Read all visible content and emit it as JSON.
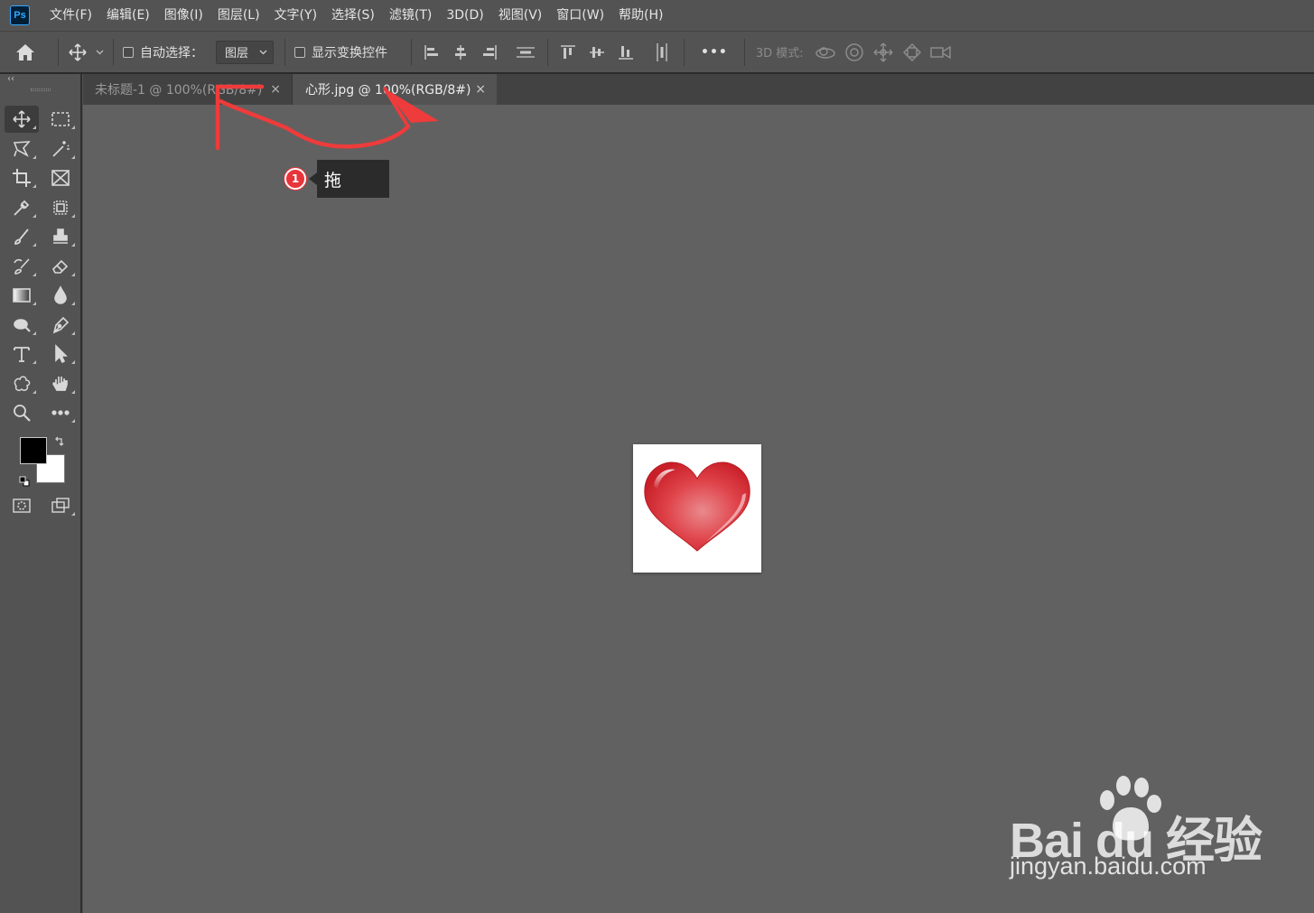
{
  "app": {
    "logo_text": "Ps"
  },
  "menu": [
    "文件(F)",
    "编辑(E)",
    "图像(I)",
    "图层(L)",
    "文字(Y)",
    "选择(S)",
    "滤镜(T)",
    "3D(D)",
    "视图(V)",
    "窗口(W)",
    "帮助(H)"
  ],
  "options": {
    "auto_select_label": "自动选择：",
    "auto_select_value": "图层",
    "show_transform_label": "显示变换控件",
    "more_label": "•••",
    "mode3d_label": "3D 模式:"
  },
  "tabs": [
    {
      "title": "未标题-1 @ 100%(RGB/8#)",
      "close": "×",
      "active": false
    },
    {
      "title": "心形.jpg @ 100%(RGB/8#)",
      "close": "×",
      "active": true
    }
  ],
  "toolbar": {
    "collapse_label": "‹‹",
    "foreground_color": "#000000",
    "background_color": "#ffffff"
  },
  "annotation": {
    "step_number": "1",
    "text": "拖",
    "color": "#e8343a"
  },
  "watermark": {
    "brand": "Bai du 经验",
    "url": "jingyan.baidu.com"
  },
  "colors": {
    "chrome": "#535353",
    "workspace": "#616161",
    "tabbar": "#424242"
  }
}
